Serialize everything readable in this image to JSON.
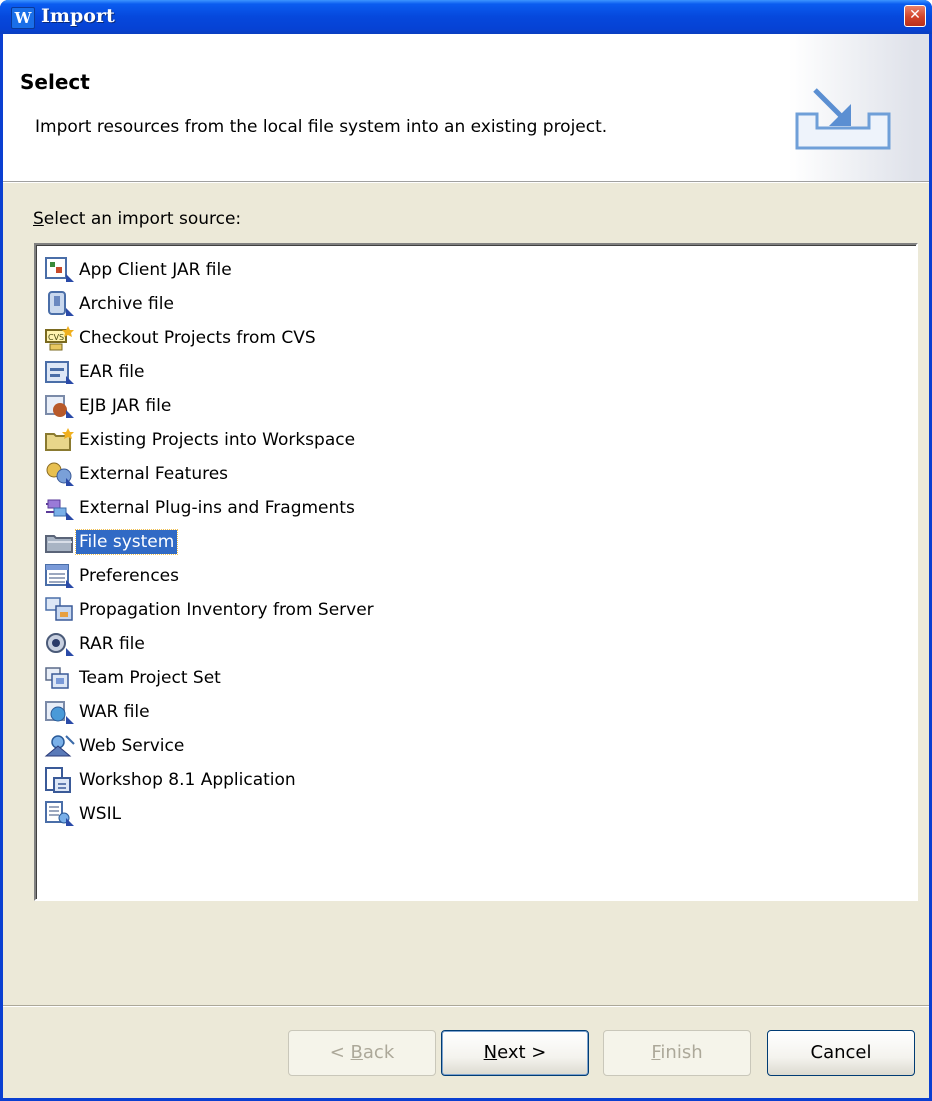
{
  "window": {
    "title": "Import",
    "app_icon": "W"
  },
  "banner": {
    "title": "Select",
    "description": "Import resources from the local file system into an existing project."
  },
  "source_label": {
    "underlined": "S",
    "rest": "elect an import source:"
  },
  "sources": [
    {
      "label": "App Client JAR file",
      "icon": "app-client-jar-icon",
      "selected": false
    },
    {
      "label": "Archive file",
      "icon": "archive-file-icon",
      "selected": false
    },
    {
      "label": "Checkout Projects from CVS",
      "icon": "cvs-checkout-icon",
      "selected": false
    },
    {
      "label": "EAR file",
      "icon": "ear-file-icon",
      "selected": false
    },
    {
      "label": "EJB JAR file",
      "icon": "ejb-jar-icon",
      "selected": false
    },
    {
      "label": "Existing Projects into Workspace",
      "icon": "existing-projects-icon",
      "selected": false
    },
    {
      "label": "External Features",
      "icon": "external-features-icon",
      "selected": false
    },
    {
      "label": "External Plug-ins and Fragments",
      "icon": "external-plugins-icon",
      "selected": false
    },
    {
      "label": "File system",
      "icon": "file-system-icon",
      "selected": true
    },
    {
      "label": "Preferences",
      "icon": "preferences-icon",
      "selected": false
    },
    {
      "label": "Propagation Inventory from Server",
      "icon": "propagation-inventory-icon",
      "selected": false
    },
    {
      "label": "RAR file",
      "icon": "rar-file-icon",
      "selected": false
    },
    {
      "label": "Team Project Set",
      "icon": "team-project-set-icon",
      "selected": false
    },
    {
      "label": "WAR file",
      "icon": "war-file-icon",
      "selected": false
    },
    {
      "label": "Web Service",
      "icon": "web-service-icon",
      "selected": false
    },
    {
      "label": "Workshop 8.1 Application",
      "icon": "workshop-application-icon",
      "selected": false
    },
    {
      "label": "WSIL",
      "icon": "wsil-icon",
      "selected": false
    }
  ],
  "buttons": {
    "back": {
      "prefix": "< ",
      "underlined": "B",
      "rest": "ack",
      "enabled": false
    },
    "next": {
      "underlined": "N",
      "rest": "ext >",
      "enabled": true
    },
    "finish": {
      "underlined": "F",
      "rest": "inish",
      "enabled": false
    },
    "cancel": {
      "label": "Cancel",
      "enabled": true
    }
  },
  "colors": {
    "titlebar": "#0648dc",
    "selection": "#316ac5",
    "dialog_bg": "#ece9d8"
  }
}
